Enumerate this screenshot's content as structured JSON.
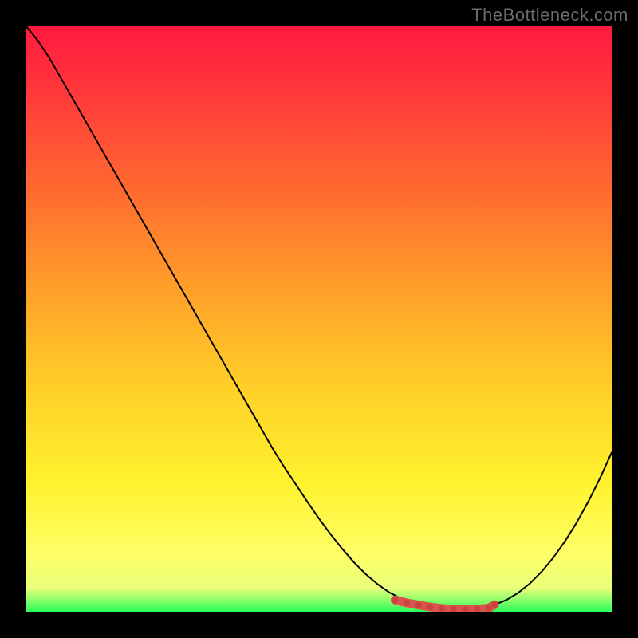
{
  "watermark": "TheBottleneck.com",
  "colors": {
    "curve": "#000000",
    "optimal": "#d9544d",
    "background_top": "#ff1a3f",
    "background_bottom": "#2bff5a"
  },
  "chart_data": {
    "type": "line",
    "title": "",
    "xlabel": "",
    "ylabel": "",
    "xlim": [
      0,
      100
    ],
    "ylim": [
      0,
      100
    ],
    "x": [
      0,
      2,
      4,
      6,
      8,
      10,
      12,
      14,
      16,
      18,
      20,
      22,
      24,
      26,
      28,
      30,
      32,
      34,
      36,
      38,
      40,
      42,
      44,
      46,
      48,
      50,
      52,
      54,
      56,
      58,
      60,
      62,
      64,
      66,
      68,
      70,
      72,
      74,
      76,
      78,
      80,
      82,
      84,
      86,
      88,
      90,
      92,
      94,
      96,
      98,
      100
    ],
    "values": [
      100,
      97.5,
      94.5,
      91,
      87.5,
      84,
      80.5,
      77,
      73.5,
      70,
      66.5,
      63,
      59.5,
      56,
      52.5,
      49,
      45.5,
      42,
      38.5,
      35,
      31.5,
      28,
      24.8,
      21.8,
      18.8,
      15.9,
      13.2,
      10.7,
      8.4,
      6.4,
      4.7,
      3.3,
      2.25,
      1.5,
      1,
      0.65,
      0.45,
      0.4,
      0.45,
      0.7,
      1.2,
      2,
      3.2,
      4.8,
      6.8,
      9.2,
      12,
      15.2,
      18.8,
      22.8,
      27.2
    ],
    "optimal_range": {
      "x_start": 63,
      "x_end": 80,
      "points_x": [
        63,
        65,
        67,
        69,
        71,
        73,
        75,
        77,
        79,
        80
      ],
      "points_y": [
        2.0,
        1.5,
        1.15,
        0.8,
        0.55,
        0.45,
        0.4,
        0.45,
        0.6,
        1.2
      ]
    }
  }
}
